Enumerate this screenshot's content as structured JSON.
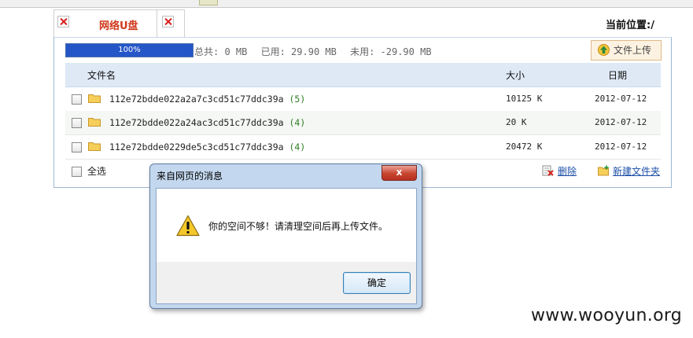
{
  "tab": {
    "title": "网络U盘"
  },
  "location": {
    "label": "当前位置:/"
  },
  "storage": {
    "progress_label": "100%",
    "progress_fraction": 1.0,
    "total": "总共: 0 MB",
    "used": "已用: 29.90 MB",
    "free": "未用: -29.90 MB"
  },
  "toolbar": {
    "upload_label": "文件上传"
  },
  "table": {
    "headers": {
      "name": "文件名",
      "size": "大小",
      "date": "日期"
    },
    "rows": [
      {
        "name": "112e72bdde022a2a7c3cd51c77ddc39a",
        "count": "(5)",
        "size": "10125 K",
        "date": "2012-07-12"
      },
      {
        "name": "112e72bdde022a24ac3cd51c77ddc39a",
        "count": "(4)",
        "size": "20 K",
        "date": "2012-07-12"
      },
      {
        "name": "112e72bdde0229de5c3cd51c77ddc39a",
        "count": "(4)",
        "size": "20472 K",
        "date": "2012-07-12"
      }
    ]
  },
  "footer": {
    "select_all": "全选",
    "delete": "删除",
    "new_folder": "新建文件夹"
  },
  "dialog": {
    "title": "来自网页的消息",
    "close": "x",
    "message": "你的空间不够！请清理空间后再上传文件。",
    "ok": "确定"
  },
  "watermark": "www.wooyun.org",
  "colors": {
    "progress": "#2456c7",
    "tab_title": "#d0371a",
    "link": "#1d4fa8",
    "count": "#2e7d22"
  }
}
